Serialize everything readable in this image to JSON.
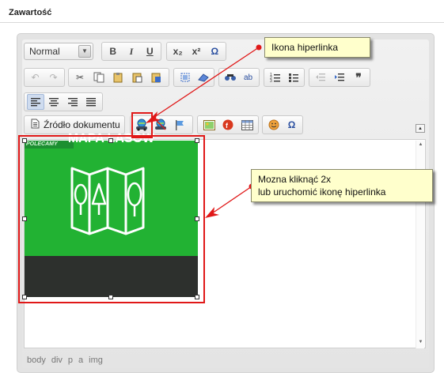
{
  "section": {
    "title": "Zawartość"
  },
  "toolbar": {
    "format_select": "Normal",
    "source_button_label": "Źródło dokumentu",
    "bold": "B",
    "italic": "I",
    "underline": "U",
    "subscript": "x₂",
    "superscript": "x²",
    "special_char": "Ω",
    "blockquote": "❞",
    "omega2": "Ω"
  },
  "image": {
    "tag": "POLECAMY",
    "caption": "MAPA LASÓW",
    "fill_color": "#22b233",
    "caption_bar_color": "#2d302d"
  },
  "annotations": {
    "callout_link_icon": "Ikona hiperlinka",
    "callout_double_click_line1": "Mozna kliknąć 2x",
    "callout_double_click_line2": "lub uruchomić ikonę hiperlinka",
    "highlight_color": "#e01818"
  },
  "statusbar": {
    "path": [
      "body",
      "div",
      "p",
      "a",
      "img"
    ]
  }
}
